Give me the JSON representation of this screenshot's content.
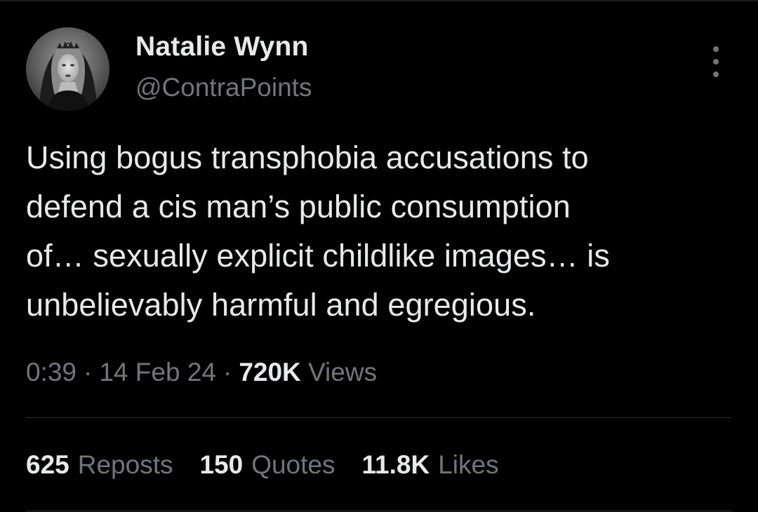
{
  "tweet": {
    "author": {
      "display_name": "Natalie Wynn",
      "handle": "@ContraPoints"
    },
    "text": "Using bogus transphobia accusations to\ndefend a cis man’s public consumption\nof… sexually explicit childlike images… is\nunbelievably harmful and egregious.",
    "meta": {
      "time": "0:39",
      "separator": "·",
      "date": "14 Feb 24",
      "views_count": "720K",
      "views_label": "Views"
    },
    "stats": [
      {
        "count": "625",
        "label": "Reposts"
      },
      {
        "count": "150",
        "label": "Quotes"
      },
      {
        "count": "11.8K",
        "label": "Likes"
      }
    ]
  },
  "icons": {
    "more": "more-options-icon",
    "avatar": "profile-photo"
  },
  "colors": {
    "background": "#000000",
    "primary_text": "#e7e9ea",
    "secondary_text": "#71767b",
    "divider": "#2f3336"
  }
}
